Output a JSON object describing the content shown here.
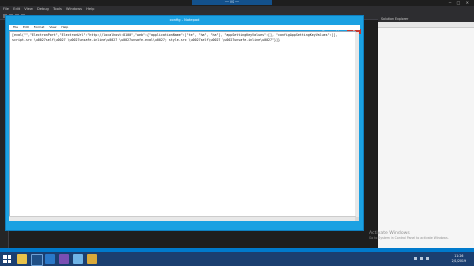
{
  "vs": {
    "remote_title": "── VS ──",
    "menu": [
      "File",
      "Edit",
      "View",
      "Debug",
      "Tools",
      "Windows",
      "Help"
    ],
    "window_controls": "─ □ ✕"
  },
  "solution_explorer": {
    "title": "Solution Explorer"
  },
  "notepad": {
    "title": "config - Notepad",
    "menu": [
      "File",
      "Edit",
      "Format",
      "View",
      "Help"
    ],
    "content_lines": [
      "[eval(\"\",\"ElectronPort\",\"ElectronUrl\":\"http://localhost:8100\",\"web\":{\"applicationName\":[\"te\", \"ha\", \"ha\"], \"appSettingKeyValues\":[], \"configAppSettingKeyValues\":[],",
      "script-src \\u0027self\\u0027 \\u0027unsafe-inline\\u0027 \\u0027unsafe-eval\\u0027; style-src \\u0027self\\u0027 \\u0027unsafe-inline\\u0027\"}]}"
    ]
  },
  "watermark": {
    "title": "Activate Windows",
    "subtitle": "Go to System in Control Panel to activate Windows."
  },
  "taskbar": {
    "time": "11:26",
    "date": "2/1/2019",
    "apps": [
      "explorer",
      "powershell",
      "ie",
      "vs",
      "notepad",
      "folder"
    ]
  }
}
